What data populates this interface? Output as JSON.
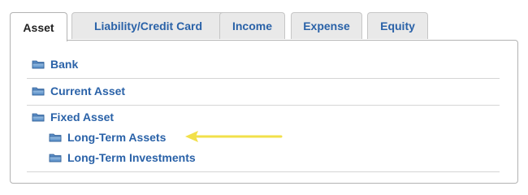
{
  "tabs": [
    {
      "label": "Asset",
      "active": true
    },
    {
      "label": "Liability/Credit Card",
      "active": false
    },
    {
      "label": "Income",
      "active": false
    },
    {
      "label": "Expense",
      "active": false
    },
    {
      "label": "Equity",
      "active": false
    }
  ],
  "accounts": [
    {
      "label": "Bank",
      "icon": "folder-icon"
    },
    {
      "label": "Current Asset",
      "icon": "folder-icon"
    },
    {
      "label": "Fixed Asset",
      "icon": "folder-icon",
      "children": [
        {
          "label": "Long-Term Assets",
          "icon": "folder-icon"
        },
        {
          "label": "Long-Term Investments",
          "icon": "folder-icon"
        }
      ]
    }
  ],
  "colors": {
    "link": "#2a62a8",
    "highlight_arrow": "#f2e04a"
  }
}
